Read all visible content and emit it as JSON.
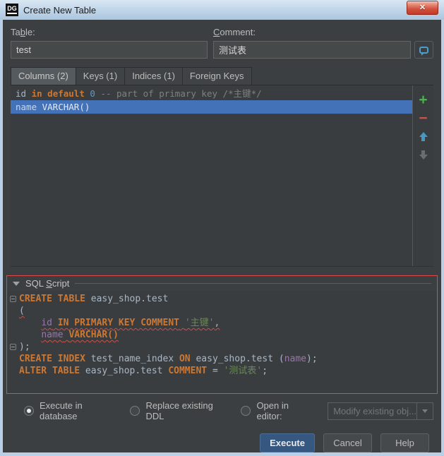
{
  "window": {
    "title": "Create New Table",
    "app_badge": "DG",
    "close_glyph": "✕"
  },
  "form": {
    "table_label": {
      "pre": "Ta",
      "mnemonic": "b",
      "post": "le:"
    },
    "table_value": "test",
    "comment_label": {
      "pre": "",
      "mnemonic": "C",
      "post": "omment:"
    },
    "comment_value": "测试表",
    "comment_button_icon": "speech-bubble-icon"
  },
  "tabs": [
    {
      "label": "Columns (2)"
    },
    {
      "label": "Keys (1)"
    },
    {
      "label": "Indices (1)"
    },
    {
      "label": "Foreign Keys"
    }
  ],
  "columns_list": {
    "rows": [
      {
        "tokens": [
          {
            "t": "id ",
            "c": "txt"
          },
          {
            "t": "in",
            "c": "kw"
          },
          {
            "t": " ",
            "c": "txt"
          },
          {
            "t": "default",
            "c": "kw"
          },
          {
            "t": " ",
            "c": "txt"
          },
          {
            "t": "0",
            "c": "num"
          },
          {
            "t": " -- part of primary key /*主键*/",
            "c": "cmt"
          }
        ]
      },
      {
        "tokens": [
          {
            "t": "name",
            "c": "selid"
          },
          {
            "t": " VARCHAR()",
            "c": "sel"
          }
        ]
      }
    ]
  },
  "list_toolbar": {
    "add": "+",
    "remove": "−",
    "up": "move-up-arrow",
    "down": "move-down-arrow"
  },
  "sql_script": {
    "header": {
      "pre": "SQL ",
      "mnemonic": "S",
      "post": "cript"
    },
    "lines": [
      [
        {
          "t": "CREATE TABLE",
          "c": "kw"
        },
        {
          "t": " easy_shop.test",
          "c": "txt"
        }
      ],
      [
        {
          "t": "(",
          "c": "txt err"
        }
      ],
      [
        {
          "t": "    ",
          "c": "txt"
        },
        {
          "t": "id",
          "c": "idn err"
        },
        {
          "t": " ",
          "c": "txt err"
        },
        {
          "t": "IN PRIMARY KEY COMMENT",
          "c": "kw err"
        },
        {
          "t": " ",
          "c": "txt err"
        },
        {
          "t": "'主键'",
          "c": "str err"
        },
        {
          "t": ",",
          "c": "txt err"
        }
      ],
      [
        {
          "t": "    ",
          "c": "txt"
        },
        {
          "t": "name",
          "c": "idn err"
        },
        {
          "t": " ",
          "c": "txt err"
        },
        {
          "t": "VARCHAR()",
          "c": "kw err"
        }
      ],
      [
        {
          "t": ");",
          "c": "txt"
        }
      ],
      [
        {
          "t": "CREATE INDEX",
          "c": "kw"
        },
        {
          "t": " test_name_index ",
          "c": "txt"
        },
        {
          "t": "ON",
          "c": "kw"
        },
        {
          "t": " easy_shop.test (",
          "c": "txt"
        },
        {
          "t": "name",
          "c": "idn"
        },
        {
          "t": ");",
          "c": "txt"
        }
      ],
      [
        {
          "t": "ALTER TABLE",
          "c": "kw"
        },
        {
          "t": " easy_shop.test ",
          "c": "txt"
        },
        {
          "t": "COMMENT",
          "c": "kw"
        },
        {
          "t": " = ",
          "c": "txt"
        },
        {
          "t": "'测试表'",
          "c": "str"
        },
        {
          "t": ";",
          "c": "txt"
        }
      ]
    ]
  },
  "options": {
    "radios": [
      {
        "label": "Execute in database",
        "selected": true
      },
      {
        "label": "Replace existing DDL",
        "selected": false
      },
      {
        "label": "Open in editor:",
        "selected": false
      }
    ],
    "editor_dropdown": {
      "value": "Modify existing obj...",
      "disabled": true
    }
  },
  "buttons": {
    "execute": "Execute",
    "cancel": "Cancel",
    "help": "Help"
  },
  "colors": {
    "selection_blue": "#4472b8",
    "error_border_red": "#dd4b44",
    "keyword_orange": "#cc7832",
    "string_green": "#6a8759",
    "comment_gray": "#808080",
    "number_blue": "#6897bb",
    "identifier_purple": "#9876aa",
    "dialog_bg": "#3c3f41",
    "titlebar_blue": "#c3d7ea",
    "default_button_blue": "#365880"
  }
}
